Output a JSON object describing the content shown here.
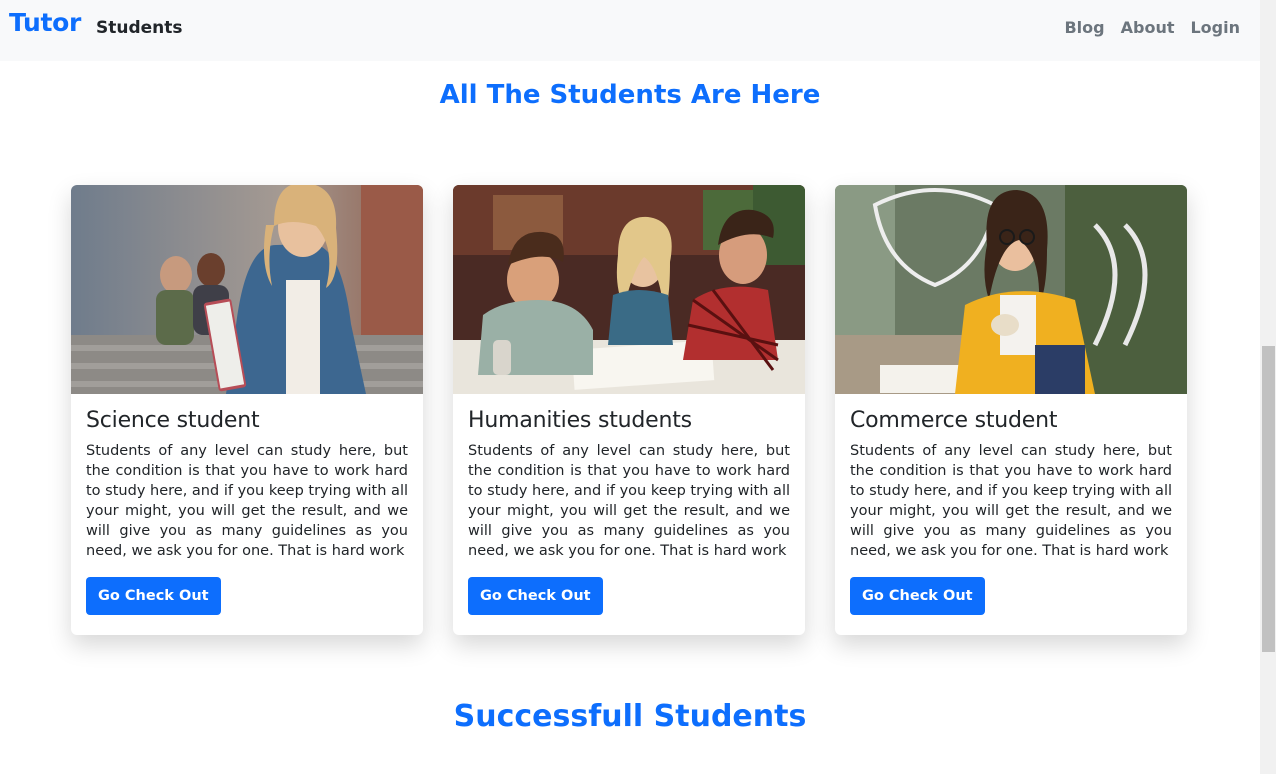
{
  "nav": {
    "brand": "Tutor",
    "left_link": "Students",
    "right_links": [
      "Blog",
      "About",
      "Login"
    ]
  },
  "headings": {
    "main": "All The Students Are Here",
    "secondary": "Successfull Students"
  },
  "cards": [
    {
      "title": "Science student",
      "text": "Students of any level can study here, but the condition is that you have to work hard to study here, and if you keep trying with all your might, you will get the result, and we will give you as many guidelines as you need, we ask you for one. That is hard work",
      "button": "Go Check Out"
    },
    {
      "title": "Humanities students",
      "text": "Students of any level can study here, but the condition is that you have to work hard to study here, and if you keep trying with all your might, you will get the result, and we will give you as many guidelines as you need, we ask you for one. That is hard work",
      "button": "Go Check Out"
    },
    {
      "title": "Commerce student",
      "text": "Students of any level can study here, but the condition is that you have to work hard to study here, and if you keep trying with all your might, you will get the result, and we will give you as many guidelines as you need, we ask you for one. That is hard work",
      "button": "Go Check Out"
    }
  ],
  "colors": {
    "primary": "#0d6efd",
    "navbar_bg": "#f8f9fa",
    "nav_link": "#6c757d",
    "text": "#212529"
  }
}
